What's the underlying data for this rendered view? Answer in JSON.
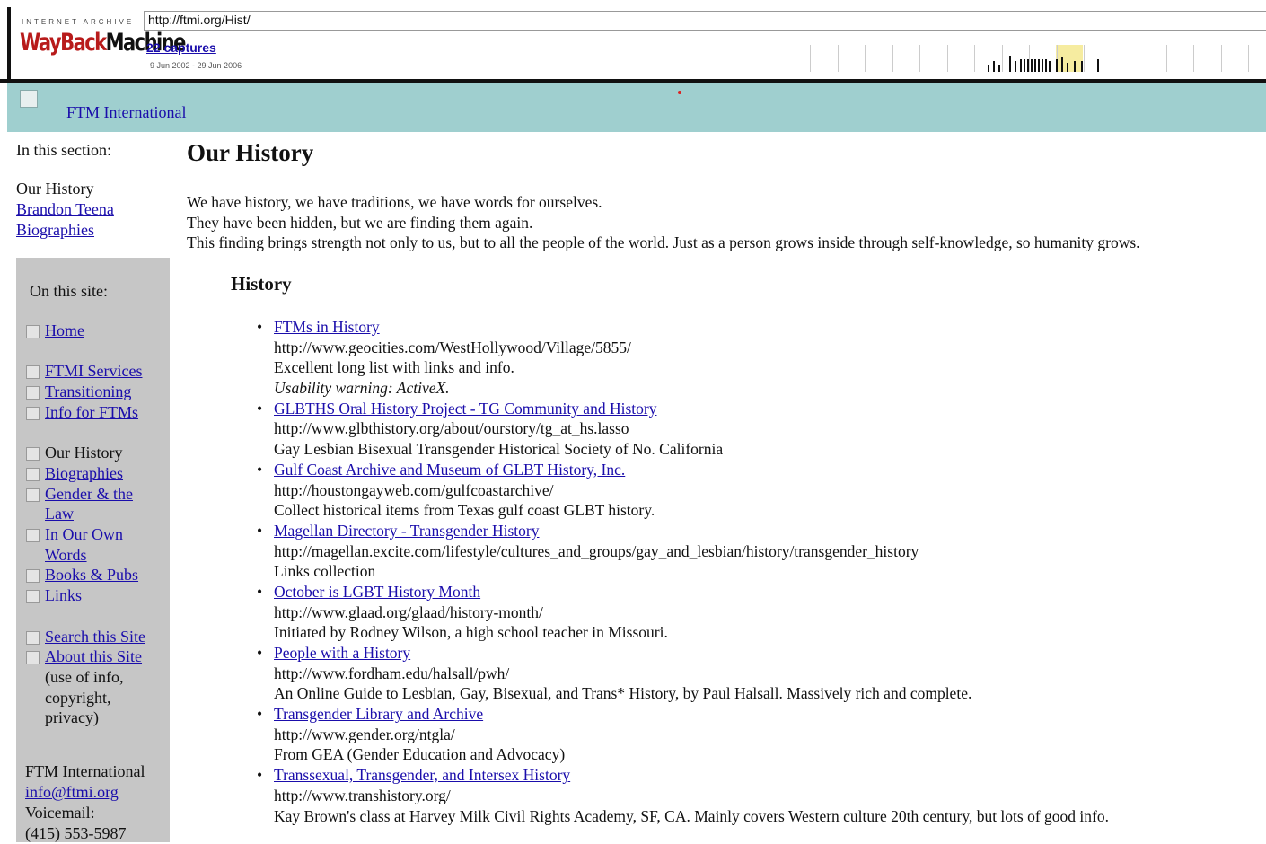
{
  "wayback": {
    "archive_label": "INTERNET ARCHIVE",
    "logo_part1": "WayBack",
    "logo_part2": "Machine",
    "url": "http://ftmi.org/Hist/",
    "captures": "22 captures",
    "date_range": "9 Jun 2002 - 29 Jun 2006"
  },
  "header": {
    "site_link": "FTM International",
    "band_color": "#9fcfcf"
  },
  "section": {
    "label": "In this section:",
    "current": "Our History",
    "links": [
      "Brandon Teena",
      "Biographies"
    ]
  },
  "sidebar": {
    "title": "On this site:",
    "home": "Home",
    "services": "FTMI Services",
    "transitioning": "Transitioning",
    "info_ftms": "Info for FTMs",
    "our_history": "Our History",
    "biographies": "Biographies",
    "gender_law_1": "Gender & the",
    "gender_law_2": "Law",
    "own_words_1": "In Our Own",
    "own_words_2": "Words",
    "books": "Books & Pubs",
    "links": "Links",
    "search": "Search this Site",
    "about": "About this Site",
    "about_note_1": "(use of info,",
    "about_note_2": "copyright,",
    "about_note_3": "privacy)",
    "org_name": "FTM International",
    "email": "info@ftmi.org",
    "voicemail_label": "Voicemail:",
    "phone": "(415) 553-5987"
  },
  "main": {
    "title": "Our History",
    "intro": [
      "We have history, we have traditions, we have words for ourselves.",
      "They have been hidden, but we are finding them again.",
      "This finding brings strength not only to us, but to all the people of the world. Just as a person grows inside through self-knowledge, so humanity grows."
    ],
    "subheading": "History",
    "entries": [
      {
        "title": "FTMs in History",
        "url": "http://www.geocities.com/WestHollywood/Village/5855/",
        "desc": "Excellent long list with links and info.",
        "note": "Usability warning: ActiveX."
      },
      {
        "title": "GLBTHS Oral History Project - TG Community and History",
        "url": "http://www.glbthistory.org/about/ourstory/tg_at_hs.lasso",
        "desc": "Gay Lesbian Bisexual Transgender Historical Society of No. California"
      },
      {
        "title": "Gulf Coast Archive and Museum of GLBT History, Inc.",
        "url": "http://houstongayweb.com/gulfcoastarchive/",
        "desc": "Collect historical items from Texas gulf coast GLBT history."
      },
      {
        "title": "Magellan Directory - Transgender History",
        "url": "http://magellan.excite.com/lifestyle/cultures_and_groups/gay_and_lesbian/history/transgender_history",
        "desc": "Links collection"
      },
      {
        "title": "October is LGBT History Month",
        "url": "http://www.glaad.org/glaad/history-month/",
        "desc": "Initiated by Rodney Wilson, a high school teacher in Missouri."
      },
      {
        "title": "People with a History",
        "url": "http://www.fordham.edu/halsall/pwh/",
        "desc": "An Online Guide to Lesbian, Gay, Bisexual, and Trans* History, by Paul Halsall. Massively rich and complete."
      },
      {
        "title": "Transgender Library and Archive",
        "url": "http://www.gender.org/ntgla/",
        "desc": "From GEA (Gender Education and Advocacy)"
      },
      {
        "title": "Transsexual, Transgender, and Intersex History",
        "url": "http://www.transhistory.org/",
        "desc": "Kay Brown's class at Harvey Milk Civil Rights Academy, SF, CA. Mainly covers Western culture 20th century, but lots of good info."
      }
    ]
  }
}
